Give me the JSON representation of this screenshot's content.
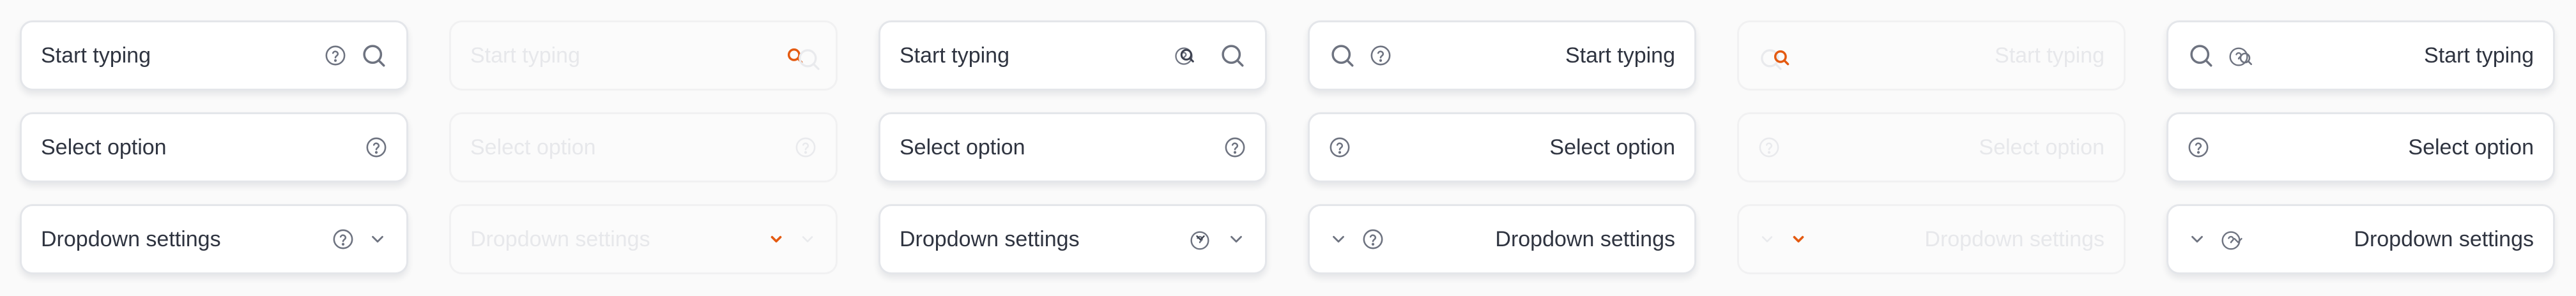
{
  "panels": [
    {
      "state": "default",
      "direction": "ltr",
      "fields": {
        "search": {
          "label": "Start typing",
          "icons": [
            "help-circle-icon",
            "search-icon"
          ]
        },
        "select": {
          "label": "Select option",
          "icons": [
            "help-circle-icon"
          ]
        },
        "dropdown": {
          "label": "Dropdown settings",
          "icons": [
            "help-circle-icon",
            "chevron-down-icon"
          ]
        }
      }
    },
    {
      "state": "disabled",
      "direction": "ltr",
      "fields": {
        "search": {
          "label": "Start typing",
          "icons": [
            "help-circle-icon",
            "search-icon"
          ]
        },
        "select": {
          "label": "Select option",
          "icons": [
            "help-circle-icon"
          ]
        },
        "dropdown": {
          "label": "Dropdown settings",
          "icons": [
            "help-circle-icon",
            "chevron-down-icon"
          ]
        }
      }
    },
    {
      "state": "overlapping-icons",
      "direction": "ltr",
      "fields": {
        "search": {
          "label": "Start typing",
          "icons": [
            "help-circle-icon",
            "search-icon"
          ]
        },
        "select": {
          "label": "Select option",
          "icons": [
            "help-circle-icon"
          ]
        },
        "dropdown": {
          "label": "Dropdown settings",
          "icons": [
            "help-circle-icon",
            "chevron-down-icon"
          ]
        }
      }
    },
    {
      "state": "default",
      "direction": "rtl",
      "fields": {
        "search": {
          "label": "Start typing",
          "icons": [
            "search-icon",
            "help-circle-icon"
          ]
        },
        "select": {
          "label": "Select option",
          "icons": [
            "help-circle-icon"
          ]
        },
        "dropdown": {
          "label": "Dropdown settings",
          "icons": [
            "chevron-down-icon",
            "help-circle-icon"
          ]
        }
      }
    },
    {
      "state": "disabled",
      "direction": "rtl",
      "fields": {
        "search": {
          "label": "Start typing",
          "icons": [
            "search-icon",
            "help-circle-icon"
          ]
        },
        "select": {
          "label": "Select option",
          "icons": [
            "help-circle-icon"
          ]
        },
        "dropdown": {
          "label": "Dropdown settings",
          "icons": [
            "chevron-down-icon",
            "help-circle-icon"
          ]
        }
      }
    },
    {
      "state": "overlapping-icons",
      "direction": "rtl",
      "fields": {
        "search": {
          "label": "Start typing",
          "icons": [
            "search-icon",
            "help-circle-icon"
          ]
        },
        "select": {
          "label": "Select option",
          "icons": [
            "help-circle-icon"
          ]
        },
        "dropdown": {
          "label": "Dropdown settings",
          "icons": [
            "chevron-down-icon",
            "help-circle-icon"
          ]
        }
      }
    }
  ],
  "colors": {
    "text": "#2f3440",
    "icon": "#6e7380",
    "border": "#e4e6ea",
    "accent": "#e45a11",
    "faded_text": "#e7e8eb"
  }
}
